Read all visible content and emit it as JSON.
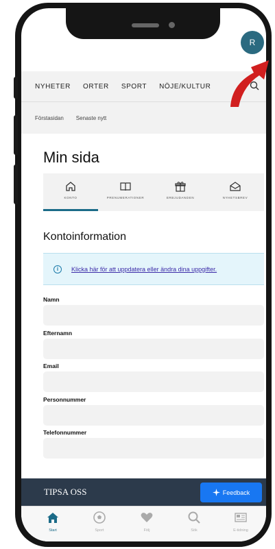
{
  "avatar_initial": "R",
  "topnav": [
    "NYHETER",
    "ORTER",
    "SPORT",
    "NÖJE/KULTUR"
  ],
  "subnav": [
    "Förstasidan",
    "Senaste nytt"
  ],
  "page_title": "Min sida",
  "tabs": [
    {
      "label": "KONTO",
      "icon": "home-icon",
      "active": true
    },
    {
      "label": "PRENUMERATIONER",
      "icon": "book-icon",
      "active": false
    },
    {
      "label": "ERBJUDANDEN",
      "icon": "gift-icon",
      "active": false
    },
    {
      "label": "NYHETSBREV",
      "icon": "envelope-icon",
      "active": false
    }
  ],
  "section_title": "Kontoinformation",
  "info_link": "Klicka här för att uppdatera eller ändra dina uppgifter.",
  "fields": [
    {
      "label": "Namn",
      "value": ""
    },
    {
      "label": "Efternamn",
      "value": ""
    },
    {
      "label": "Email",
      "value": ""
    },
    {
      "label": "Personnummer",
      "value": ""
    },
    {
      "label": "Telefonnummer",
      "value": ""
    }
  ],
  "footer_title": "TIPSA OSS",
  "feedback_label": "Feedback",
  "bottomnav": [
    {
      "label": "Start",
      "icon": "home-icon",
      "active": true
    },
    {
      "label": "Sport",
      "icon": "football-icon",
      "active": false
    },
    {
      "label": "Följ",
      "icon": "heart-icon",
      "active": false
    },
    {
      "label": "Sök",
      "icon": "search-icon",
      "active": false
    },
    {
      "label": "E-tidning",
      "icon": "newspaper-icon",
      "active": false
    }
  ],
  "colors": {
    "accent": "#1b6b88",
    "feedback": "#1877f2",
    "footer": "#2c3a4b",
    "arrow": "#d11f1f"
  }
}
